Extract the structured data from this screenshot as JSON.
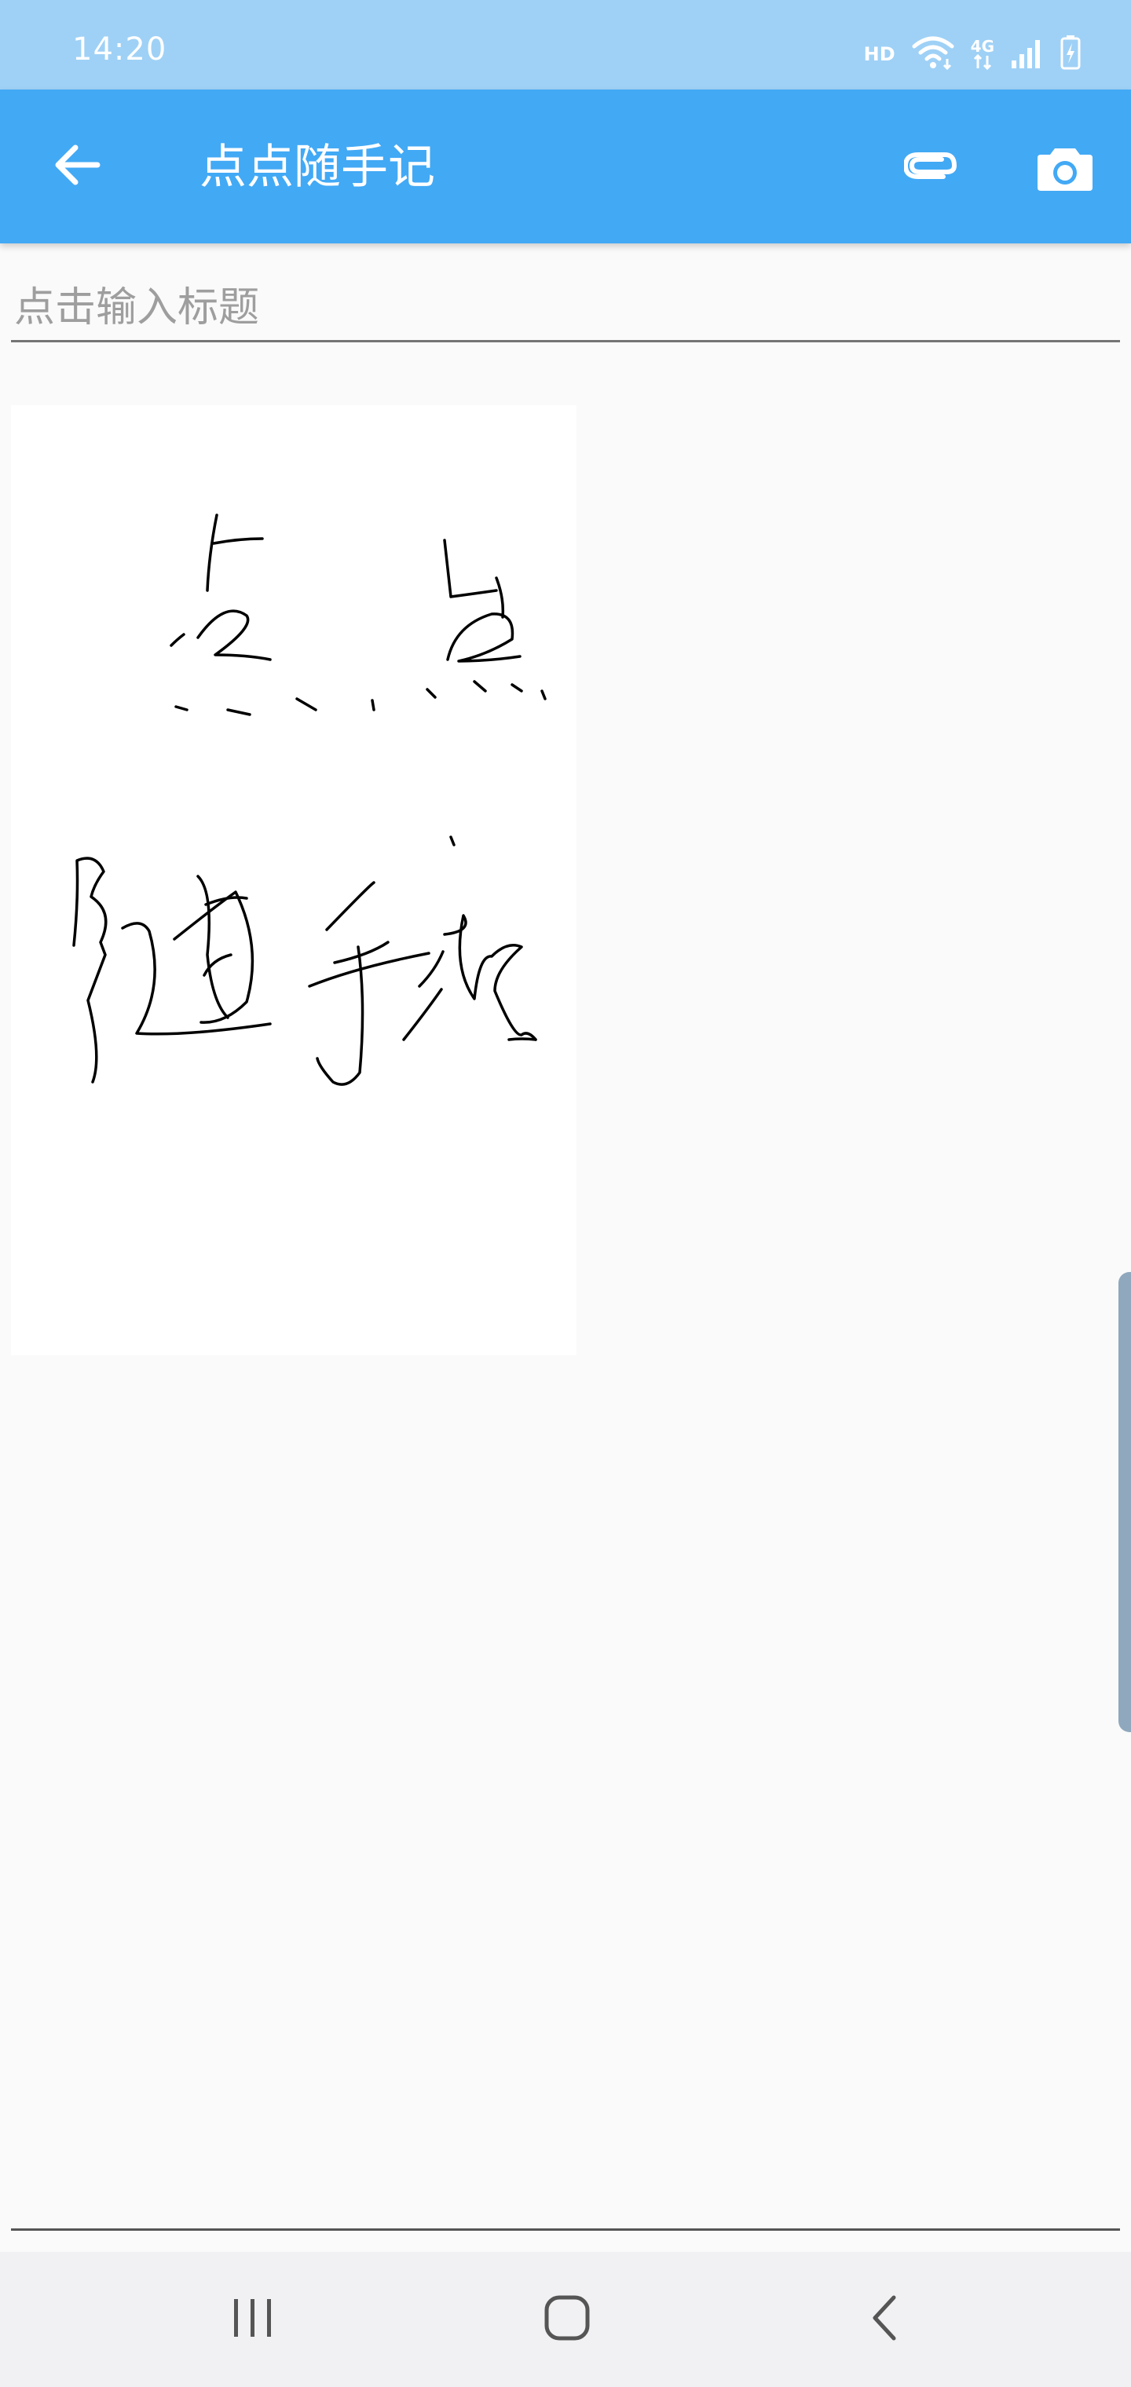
{
  "status_bar": {
    "time": "14:20",
    "hd_label": "HD",
    "network_label": "4G",
    "icons": [
      "hd-icon",
      "wifi-icon",
      "4g-icon",
      "signal-icon",
      "battery-charging-icon"
    ]
  },
  "app_bar": {
    "title": "点点随手记",
    "back_icon": "arrow-left-icon",
    "attach_icon": "paperclip-icon",
    "camera_icon": "camera-icon"
  },
  "note": {
    "title_value": "",
    "title_placeholder": "点击输入标题",
    "handwriting_text": "点点随手记"
  },
  "nav_bar": {
    "recents_icon": "recents-icon",
    "home_icon": "home-icon",
    "back_icon": "chevron-left-icon"
  },
  "colors": {
    "status_bar": "#9fd1f6",
    "app_bar": "#42a9f5",
    "background": "#fafafa",
    "nav_bar": "#f1f1f3"
  }
}
